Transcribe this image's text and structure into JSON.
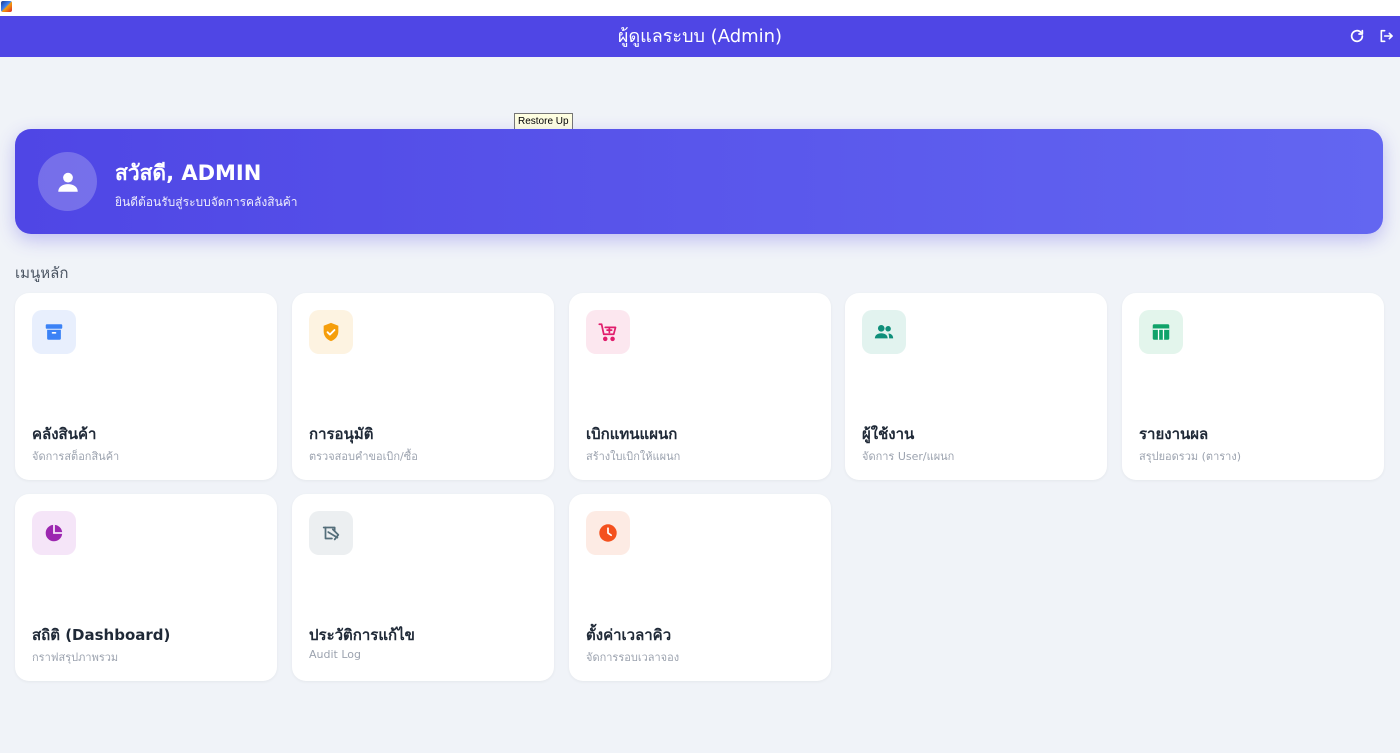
{
  "header": {
    "title": "ผู้ดูแลระบบ (Admin)",
    "refresh_icon": "refresh-icon",
    "logout_icon": "logout-icon",
    "background_color": "#4f46e5"
  },
  "tooltip": {
    "text": "Restore Up"
  },
  "welcome": {
    "greeting": "สวัสดี, ADMIN",
    "subtitle": "ยินดีต้อนรับสู่ระบบจัดการคลังสินค้า",
    "avatar_icon": "user-icon"
  },
  "menu": {
    "section_title": "เมนูหลัก",
    "items": [
      {
        "title": "คลังสินค้า",
        "subtitle": "จัดการสต็อกสินค้า",
        "icon": "archive-icon",
        "color": "#3b82f6",
        "bg": "#e8effd"
      },
      {
        "title": "การอนุมัติ",
        "subtitle": "ตรวจสอบคำขอเบิก/ซื้อ",
        "icon": "shield-check-icon",
        "color": "#f59e0b",
        "bg": "#fdf3e1"
      },
      {
        "title": "เบิกแทนแผนก",
        "subtitle": "สร้างใบเบิกให้แผนก",
        "icon": "cart-add-icon",
        "color": "#e11d6c",
        "bg": "#fce7ef"
      },
      {
        "title": "ผู้ใช้งาน",
        "subtitle": "จัดการ User/แผนก",
        "icon": "users-icon",
        "color": "#0f8f7a",
        "bg": "#e2f3ef"
      },
      {
        "title": "รายงานผล",
        "subtitle": "สรุปยอดรวม (ตาราง)",
        "icon": "table-icon",
        "color": "#10a36a",
        "bg": "#e3f5ec"
      },
      {
        "title": "สถิติ (Dashboard)",
        "subtitle": "กราฟสรุปภาพรวม",
        "icon": "pie-chart-icon",
        "color": "#9c27b0",
        "bg": "#f5e5f8"
      },
      {
        "title": "ประวัติการแก้ไข",
        "subtitle": "Audit Log",
        "icon": "history-edit-icon",
        "color": "#546e7a",
        "bg": "#eceff1"
      },
      {
        "title": "ตั้งค่าเวลาคิว",
        "subtitle": "จัดการรอบเวลาจอง",
        "icon": "clock-icon",
        "color": "#f4511e",
        "bg": "#fdebe4"
      }
    ]
  }
}
